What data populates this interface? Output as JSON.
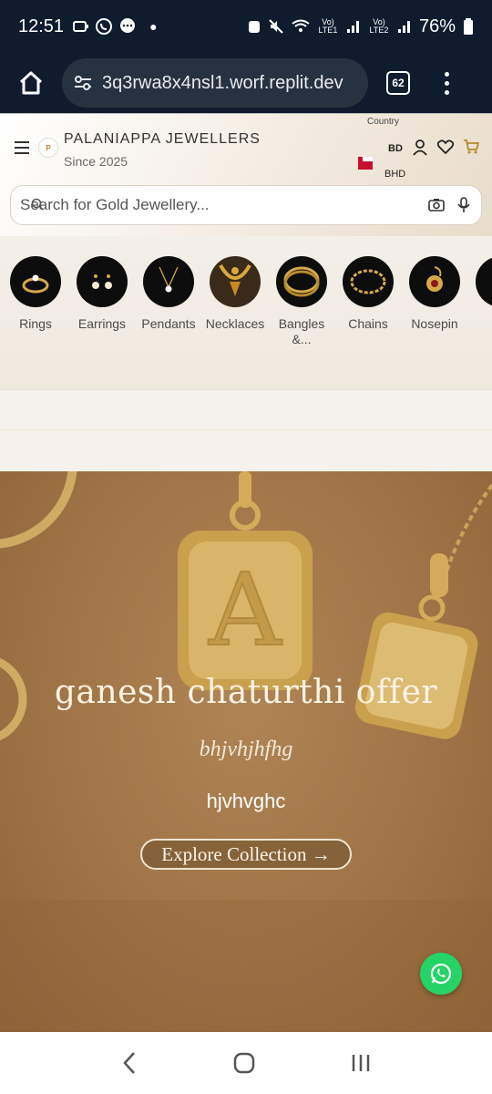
{
  "status_bar": {
    "time": "12:51",
    "volte1": "Vo) LTE1",
    "volte2": "Vo) LTE2",
    "battery": "76%"
  },
  "browser": {
    "url": "3q3rwa8x4nsl1.worf.replit.dev",
    "tab_count": "62"
  },
  "header": {
    "brand_name": "PALANIAPPA JEWELLERS",
    "tagline": "Since 2025",
    "logo_text": "P",
    "country_label": "Country",
    "country_code": "BD",
    "currency": "BHD"
  },
  "search": {
    "placeholder": "Search for Gold Jewellery..."
  },
  "categories": [
    {
      "label": "Rings",
      "icon": "ring-icon"
    },
    {
      "label": "Earrings",
      "icon": "earrings-icon"
    },
    {
      "label": "Pendants",
      "icon": "pendant-icon"
    },
    {
      "label": "Necklaces",
      "icon": "necklace-icon"
    },
    {
      "label": "Bangles &...",
      "icon": "bangles-icon"
    },
    {
      "label": "Chains",
      "icon": "chain-icon"
    },
    {
      "label": "Nosepin",
      "icon": "nosepin-icon"
    }
  ],
  "hero": {
    "title": "ganesh chaturthi offer",
    "subtitle": "bhjvhjhfhg",
    "body": "hjvhvghc",
    "cta_label": "Explore Collection →"
  },
  "colors": {
    "status_bg": "#0f1c2e",
    "hero_bg": "#a57a4b",
    "whatsapp": "#25d366",
    "cart_accent": "#b8862b"
  }
}
